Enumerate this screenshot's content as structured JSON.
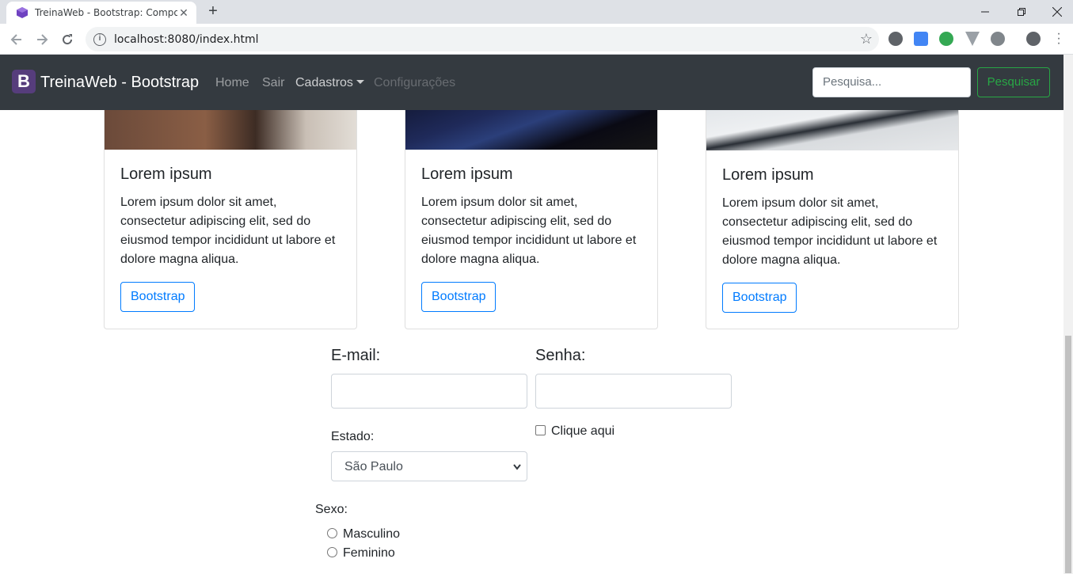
{
  "browser": {
    "tab_title": "TreinaWeb - Bootstrap: Compone",
    "tab_close": "✕",
    "new_tab": "+",
    "url": "localhost:8080/index.html"
  },
  "navbar": {
    "brand_logo": "B",
    "brand": "TreinaWeb - Bootstrap",
    "links": [
      "Home",
      "Sair",
      "Cadastros",
      "Configurações"
    ],
    "search_placeholder": "Pesquisa...",
    "search_button": "Pesquisar"
  },
  "cards": [
    {
      "title": "Lorem ipsum",
      "text": "Lorem ipsum dolor sit amet, consectetur adipiscing elit, sed do eiusmod tempor incididunt ut labore et dolore magna aliqua.",
      "button": "Bootstrap"
    },
    {
      "title": "Lorem ipsum",
      "text": "Lorem ipsum dolor sit amet, consectetur adipiscing elit, sed do eiusmod tempor incididunt ut labore et dolore magna aliqua.",
      "button": "Bootstrap"
    },
    {
      "title": "Lorem ipsum",
      "text": "Lorem ipsum dolor sit amet, consectetur adipiscing elit, sed do eiusmod tempor incididunt ut labore et dolore magna aliqua.",
      "button": "Bootstrap"
    }
  ],
  "form": {
    "email_label": "E-mail:",
    "senha_label": "Senha:",
    "estado_label": "Estado:",
    "estado_value": "São Paulo",
    "checkbox_label": "Clique aqui",
    "sexo_label": "Sexo:",
    "radio_options": [
      "Masculino",
      "Feminino"
    ]
  },
  "colors": {
    "navbar_bg": "#343a40",
    "brand_purple": "#563d7c",
    "primary": "#007bff",
    "success": "#28a745"
  }
}
